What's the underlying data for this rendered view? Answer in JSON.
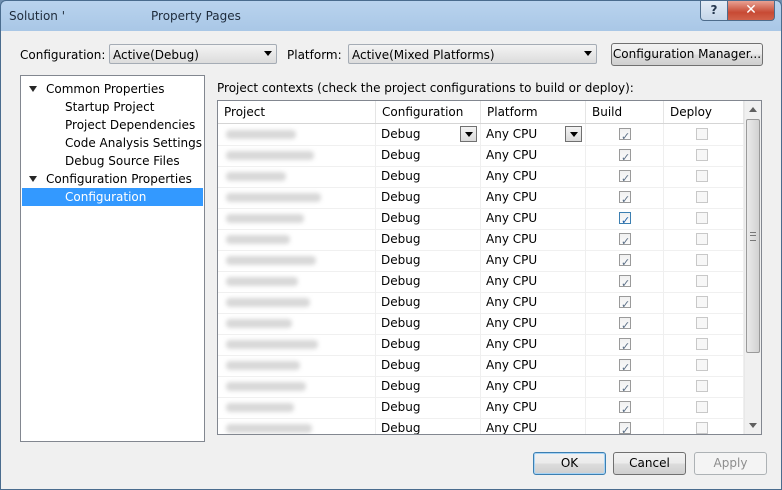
{
  "window": {
    "title_left": "Solution '",
    "title_right": "Property Pages",
    "help_label": "?",
    "close_label": "✕"
  },
  "toolbar": {
    "configuration_label": "Configuration:",
    "configuration_value": "Active(Debug)",
    "platform_label": "Platform:",
    "platform_value": "Active(Mixed Platforms)",
    "config_manager_label": "Configuration Manager..."
  },
  "tree": {
    "items": [
      {
        "label": "Common Properties",
        "level": 0,
        "expanded": true,
        "selected": false
      },
      {
        "label": "Startup Project",
        "level": 1,
        "selected": false
      },
      {
        "label": "Project Dependencies",
        "level": 1,
        "selected": false
      },
      {
        "label": "Code Analysis Settings",
        "level": 1,
        "selected": false
      },
      {
        "label": "Debug Source Files",
        "level": 1,
        "selected": false
      },
      {
        "label": "Configuration Properties",
        "level": 0,
        "expanded": true,
        "selected": false
      },
      {
        "label": "Configuration",
        "level": 1,
        "selected": true
      }
    ]
  },
  "main": {
    "contexts_label": "Project contexts (check the project configurations to build or deploy):",
    "columns": [
      "Project",
      "Configuration",
      "Platform",
      "Build",
      "Deploy"
    ],
    "rows": [
      {
        "configuration": "Debug",
        "platform": "Any CPU",
        "build": true,
        "deploy": false,
        "dropdowns": true
      },
      {
        "configuration": "Debug",
        "platform": "Any CPU",
        "build": true,
        "deploy": false
      },
      {
        "configuration": "Debug",
        "platform": "Any CPU",
        "build": true,
        "deploy": false
      },
      {
        "configuration": "Debug",
        "platform": "Any CPU",
        "build": true,
        "deploy": false
      },
      {
        "configuration": "Debug",
        "platform": "Any CPU",
        "build": true,
        "deploy": false,
        "focused": true
      },
      {
        "configuration": "Debug",
        "platform": "Any CPU",
        "build": true,
        "deploy": false
      },
      {
        "configuration": "Debug",
        "platform": "Any CPU",
        "build": true,
        "deploy": false
      },
      {
        "configuration": "Debug",
        "platform": "Any CPU",
        "build": true,
        "deploy": false
      },
      {
        "configuration": "Debug",
        "platform": "Any CPU",
        "build": true,
        "deploy": false
      },
      {
        "configuration": "Debug",
        "platform": "Any CPU",
        "build": true,
        "deploy": false
      },
      {
        "configuration": "Debug",
        "platform": "Any CPU",
        "build": true,
        "deploy": false
      },
      {
        "configuration": "Debug",
        "platform": "Any CPU",
        "build": true,
        "deploy": false
      },
      {
        "configuration": "Debug",
        "platform": "Any CPU",
        "build": true,
        "deploy": false
      },
      {
        "configuration": "Debug",
        "platform": "Any CPU",
        "build": true,
        "deploy": false
      },
      {
        "configuration": "Debug",
        "platform": "Any CPU",
        "build": true,
        "deploy": false
      }
    ]
  },
  "footer": {
    "ok_label": "OK",
    "cancel_label": "Cancel",
    "apply_label": "Apply"
  },
  "colors": {
    "selection": "#3399ff",
    "titlebar": "#b9d3ee",
    "close_button": "#c74a34"
  }
}
